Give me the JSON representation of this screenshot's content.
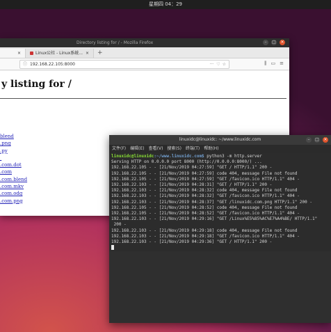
{
  "topbar": {
    "clock": "星期四 04：29"
  },
  "firefox": {
    "title": "Directory listing for / - Mozilla Firefox",
    "tabs": [
      {
        "label": ""
      },
      {
        "label": "Linux公社 - Linux系统..."
      }
    ],
    "new_tab": "+",
    "url": "192.168.22.105:8000",
    "url_more": "···",
    "heading": "y listing for /",
    "links": [
      "blend",
      ".png",
      ".py",
      "",
      ".com.dot",
      ".com",
      ".com.blend",
      ".com.mkv",
      ".com.odg",
      ".com.png"
    ]
  },
  "terminal": {
    "title": "linuxidc@linuxidc: ~/www.linuxidc.com",
    "menu": [
      "文件(F)",
      "编辑(E)",
      "查看(V)",
      "搜索(S)",
      "终端(T)",
      "帮助(H)"
    ],
    "prompt_user": "linuxidc@linuxidc",
    "prompt_path": ":~/www.linuxidc.com$",
    "command": " python3 -m http.server",
    "lines": [
      "Serving HTTP on 0.0.0.0 port 8000 (http://0.0.0.0:8000/) ...",
      "192.168.22.105 - - [21/Nov/2019 04:27:59] \"GET / HTTP/1.1\" 200 -",
      "192.168.22.105 - - [21/Nov/2019 04:27:59] code 404, message File not found",
      "192.168.22.105 - - [21/Nov/2019 04:27:59] \"GET /favicon.ico HTTP/1.1\" 404 -",
      "192.168.22.103 - - [21/Nov/2019 04:28:31] \"GET / HTTP/1.1\" 200 -",
      "192.168.22.103 - - [21/Nov/2019 04:28:32] code 404, message File not found",
      "192.168.22.103 - - [21/Nov/2019 04:28:32] \"GET /favicon.ico HTTP/1.1\" 404 -",
      "192.168.22.103 - - [21/Nov/2019 04:28:37] \"GET /linuxidc.com.png HTTP/1.1\" 200 -",
      "192.168.22.105 - - [21/Nov/2019 04:28:52] code 404, message File not found",
      "192.168.22.105 - - [21/Nov/2019 04:28:52] \"GET /favicon.ico HTTP/1.1\" 404 -",
      "192.168.22.103 - - [21/Nov/2019 04:29:16] \"GET /Linux%E5%85%AC%E7%A4%BE/ HTTP/1.1\"",
      " 200 -",
      "192.168.22.103 - - [21/Nov/2019 04:29:18] code 404, message File not found",
      "192.168.22.103 - - [21/Nov/2019 04:29:18] \"GET /favicon.ico HTTP/1.1\" 404 -",
      "192.168.22.103 - - [21/Nov/2019 04:29:36] \"GET / HTTP/1.1\" 200 -"
    ]
  }
}
